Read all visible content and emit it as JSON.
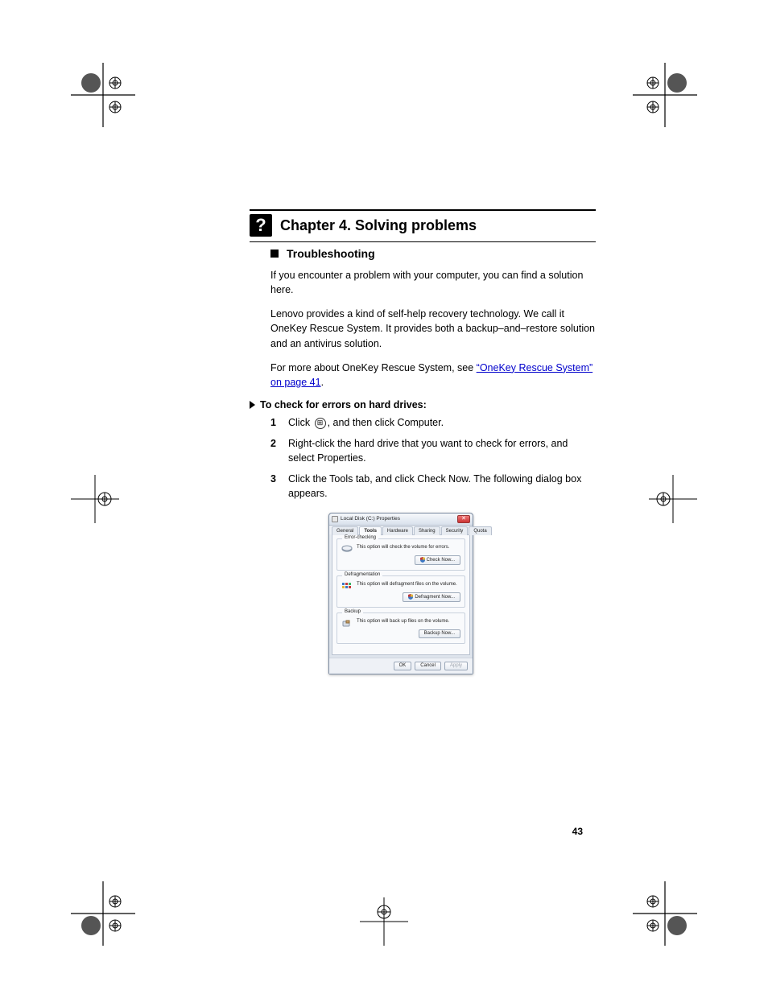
{
  "heading": "Chapter 4. Solving problems",
  "subheading": "Troubleshooting",
  "paragraphs": {
    "p1": "If you encounter a problem with your computer, you can find a solution here.",
    "p2": "Lenovo provides a kind of self-help recovery technology. We call it OneKey Rescue System. It provides both a backup–and–restore solution and an antivirus solution.",
    "p3_prefix": "For more about OneKey Rescue System, see ",
    "p3_link": "“OneKey Rescue System” on page 41",
    "p3_after": "."
  },
  "steps_lead": "To check for errors on hard drives:",
  "steps": [
    {
      "num": "1",
      "text_before": "Click ",
      "icon_name": "windows-start-icon",
      "text_after": ", and then click Computer."
    },
    {
      "num": "2",
      "text": "Right-click the hard drive that you want to check for errors, and select Properties."
    },
    {
      "num": "3",
      "text": "Click the Tools tab, and click Check Now. The following dialog box appears."
    }
  ],
  "dialog": {
    "title": "Local Disk (C:) Properties",
    "tabs": [
      "General",
      "Tools",
      "Hardware",
      "Sharing",
      "Security",
      "Quota"
    ],
    "active_tab": "Tools",
    "groups": {
      "error_checking": {
        "title": "Error-checking",
        "text": "This option will check the volume for errors.",
        "button": "Check Now..."
      },
      "defragmentation": {
        "title": "Defragmentation",
        "text": "This option will defragment files on the volume.",
        "button": "Defragment Now..."
      },
      "backup": {
        "title": "Backup",
        "text": "This option will back up files on the volume.",
        "button": "Backup Now..."
      }
    },
    "footer": {
      "ok": "OK",
      "cancel": "Cancel",
      "apply": "Apply"
    }
  },
  "page_number": "43"
}
